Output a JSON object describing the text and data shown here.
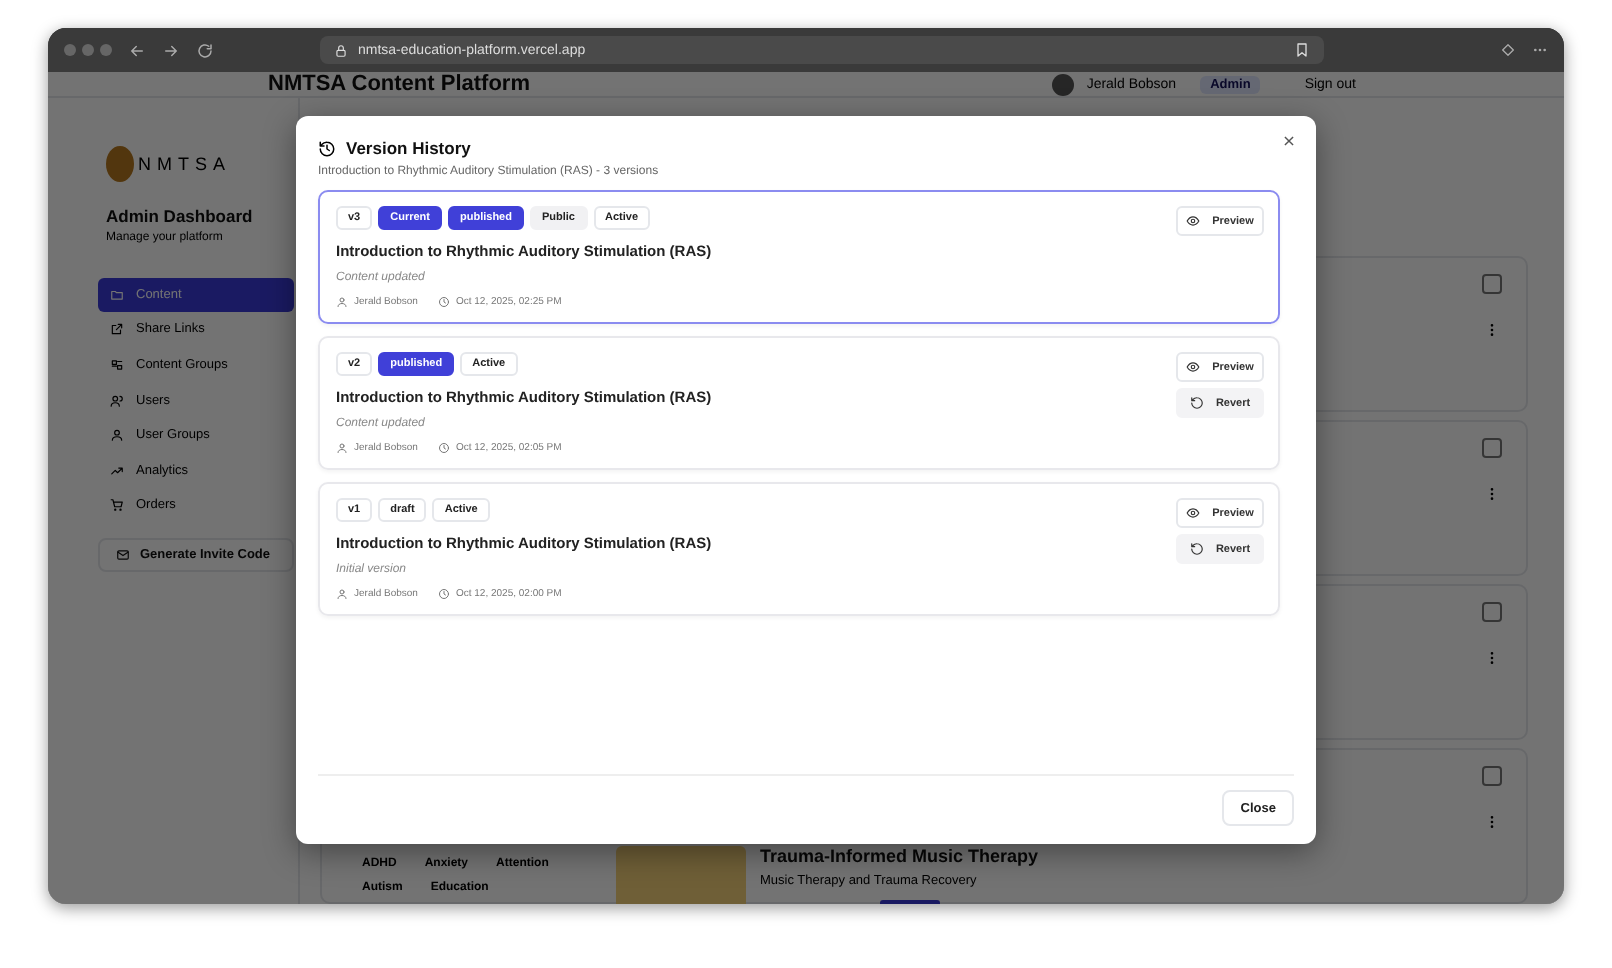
{
  "browser": {
    "url": "nmtsa-education-platform.vercel.app"
  },
  "header": {
    "title": "NMTSA Content Platform",
    "user_name": "Jerald Bobson",
    "role": "Admin",
    "sign_out": "Sign out"
  },
  "sidebar": {
    "brand": "NMTSA",
    "title": "Admin Dashboard",
    "subtitle": "Manage your platform",
    "items": [
      {
        "label": "Content",
        "selected": true
      },
      {
        "label": "Share Links",
        "selected": false
      },
      {
        "label": "Content Groups",
        "selected": false
      },
      {
        "label": "Users",
        "selected": false
      },
      {
        "label": "User Groups",
        "selected": false
      },
      {
        "label": "Analytics",
        "selected": false
      },
      {
        "label": "Orders",
        "selected": false
      }
    ],
    "invite_button": "Generate Invite Code"
  },
  "content_rows": [
    {
      "checked": false
    },
    {
      "checked": false
    },
    {
      "checked": false
    },
    {
      "checked": false,
      "tags": [
        "ADHD",
        "Anxiety",
        "Attention",
        "Autism",
        "Education"
      ],
      "title": "Trauma-Informed Music Therapy",
      "subtitle": "Music Therapy and Trauma Recovery"
    }
  ],
  "modal": {
    "title": "Version History",
    "subtitle": "Introduction to Rhythmic Auditory Stimulation (RAS) - 3 versions",
    "versions": [
      {
        "current": true,
        "badges": [
          {
            "label": "v3",
            "kind": "outline"
          },
          {
            "label": "Current",
            "kind": "filled"
          },
          {
            "label": "published",
            "kind": "filled"
          },
          {
            "label": "Public",
            "kind": "muted"
          },
          {
            "label": "Active",
            "kind": "outline"
          }
        ],
        "title": "Introduction to Rhythmic Auditory Stimulation (RAS)",
        "note": "Content updated",
        "author": "Jerald Bobson",
        "date": "Oct 12, 2025, 02:25 PM",
        "actions": [
          {
            "label": "Preview",
            "kind": "preview"
          }
        ]
      },
      {
        "current": false,
        "badges": [
          {
            "label": "v2",
            "kind": "outline"
          },
          {
            "label": "published",
            "kind": "filled"
          },
          {
            "label": "Active",
            "kind": "outline"
          }
        ],
        "title": "Introduction to Rhythmic Auditory Stimulation (RAS)",
        "note": "Content updated",
        "author": "Jerald Bobson",
        "date": "Oct 12, 2025, 02:05 PM",
        "actions": [
          {
            "label": "Preview",
            "kind": "preview"
          },
          {
            "label": "Revert",
            "kind": "revert"
          }
        ]
      },
      {
        "current": false,
        "badges": [
          {
            "label": "v1",
            "kind": "outline"
          },
          {
            "label": "draft",
            "kind": "outline"
          },
          {
            "label": "Active",
            "kind": "outline"
          }
        ],
        "title": "Introduction to Rhythmic Auditory Stimulation (RAS)",
        "note": "Initial version",
        "author": "Jerald Bobson",
        "date": "Oct 12, 2025, 02:00 PM",
        "actions": [
          {
            "label": "Preview",
            "kind": "preview"
          },
          {
            "label": "Revert",
            "kind": "revert"
          }
        ]
      }
    ],
    "close_button": "Close"
  }
}
